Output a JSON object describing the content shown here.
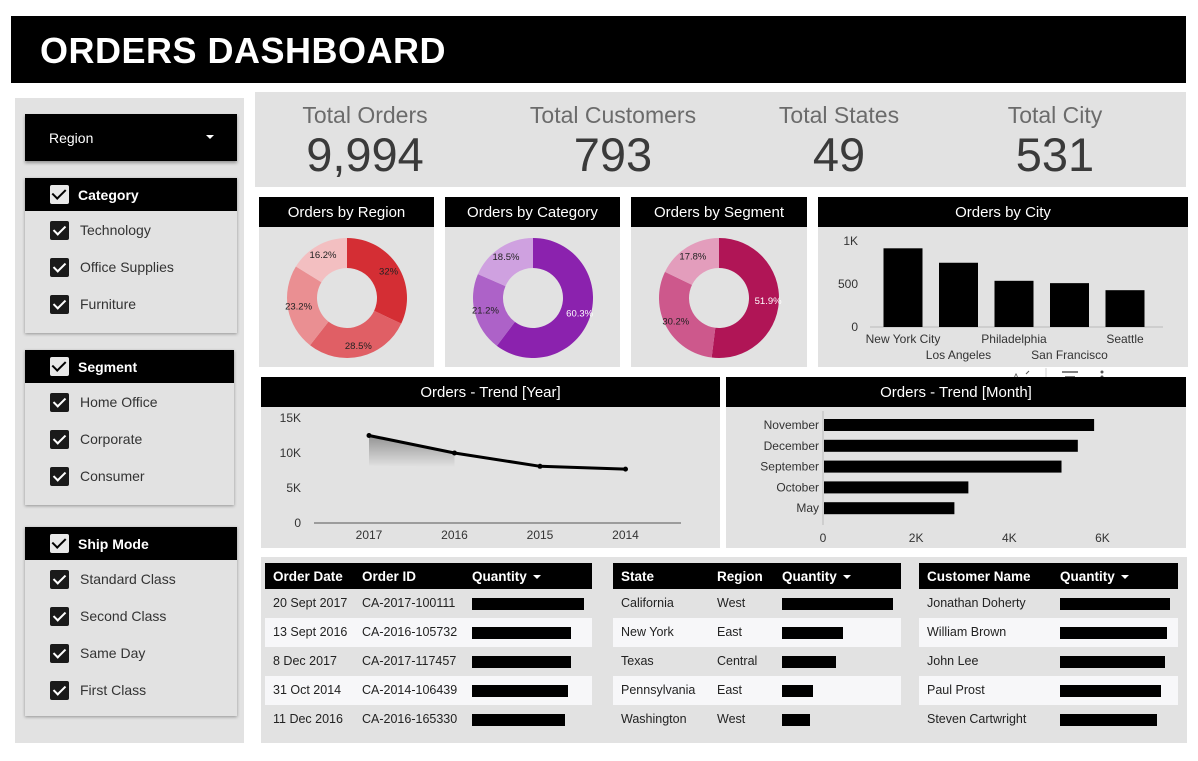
{
  "header": {
    "title": "ORDERS DASHBOARD"
  },
  "region_dropdown": {
    "label": "Region"
  },
  "filters": {
    "category": {
      "title": "Category",
      "items": [
        "Technology",
        "Office Supplies",
        "Furniture"
      ]
    },
    "segment": {
      "title": "Segment",
      "items": [
        "Home Office",
        "Corporate",
        "Consumer"
      ]
    },
    "ship_mode": {
      "title": "Ship Mode",
      "items": [
        "Standard Class",
        "Second Class",
        "Same Day",
        "First Class"
      ]
    }
  },
  "kpis": [
    {
      "label": "Total Orders",
      "value": "9,994"
    },
    {
      "label": "Total Customers",
      "value": "793"
    },
    {
      "label": "Total States",
      "value": "49"
    },
    {
      "label": "Total City",
      "value": "531"
    }
  ],
  "chart_data": [
    {
      "type": "pie",
      "title": "Orders by Region",
      "slices": [
        {
          "label": "32%",
          "value": 32,
          "color": "#d42e34"
        },
        {
          "label": "28.5%",
          "value": 28.5,
          "color": "#e05f65"
        },
        {
          "label": "23.2%",
          "value": 23.2,
          "color": "#ea8f92"
        },
        {
          "label": "16.2%",
          "value": 16.2,
          "color": "#f3bfc1"
        }
      ]
    },
    {
      "type": "pie",
      "title": "Orders by Category",
      "slices": [
        {
          "label": "60.3%",
          "value": 60.3,
          "color": "#8b22ae"
        },
        {
          "label": "21.2%",
          "value": 21.2,
          "color": "#ad62c8"
        },
        {
          "label": "18.5%",
          "value": 18.5,
          "color": "#cfa1e0"
        }
      ]
    },
    {
      "type": "pie",
      "title": "Orders by Segment",
      "slices": [
        {
          "label": "51.9%",
          "value": 51.9,
          "color": "#b01556"
        },
        {
          "label": "30.2%",
          "value": 30.2,
          "color": "#cd588c"
        },
        {
          "label": "17.8%",
          "value": 17.8,
          "color": "#e39dbc"
        }
      ]
    },
    {
      "type": "bar",
      "title": "Orders by City",
      "categories": [
        "New York City",
        "Los Angeles",
        "Philadelphia",
        "San Francisco",
        "Seattle"
      ],
      "values": [
        915,
        747,
        537,
        510,
        428
      ],
      "ylim": [
        0,
        1000
      ],
      "yticks": [
        "1K",
        "500",
        "0"
      ]
    },
    {
      "type": "line",
      "title": "Orders -  Trend [Year]",
      "x": [
        "2017",
        "2016",
        "2015",
        "2014"
      ],
      "values": [
        12500,
        10000,
        8100,
        7700
      ],
      "ylim": [
        0,
        15000
      ],
      "yticks": [
        "15K",
        "10K",
        "5K",
        "0"
      ]
    },
    {
      "type": "bar",
      "orientation": "horizontal",
      "title": "Orders -  Trend [Month]",
      "categories": [
        "November",
        "December",
        "September",
        "October",
        "May"
      ],
      "values": [
        5800,
        5450,
        5100,
        3100,
        2800
      ],
      "xlim": [
        0,
        7000
      ],
      "xticks": [
        "0",
        "2K",
        "4K",
        "6K"
      ]
    }
  ],
  "chart_tools": [
    "az-sort-icon",
    "filter-icon",
    "more-vert-icon"
  ],
  "tables": {
    "orders": {
      "columns": [
        "Order Date",
        "Order ID",
        "Quantity"
      ],
      "rows": [
        {
          "date": "20 Sept 2017",
          "id": "CA-2017-100111",
          "qty": 1.0
        },
        {
          "date": "13 Sept 2016",
          "id": "CA-2016-105732",
          "qty": 0.88
        },
        {
          "date": "8 Dec 2017",
          "id": "CA-2017-117457",
          "qty": 0.88
        },
        {
          "date": "31 Oct 2014",
          "id": "CA-2014-106439",
          "qty": 0.86
        },
        {
          "date": "11 Dec 2016",
          "id": "CA-2016-165330",
          "qty": 0.83
        }
      ]
    },
    "states": {
      "columns": [
        "State",
        "Region",
        "Quantity"
      ],
      "rows": [
        {
          "state": "California",
          "region": "West",
          "qty": 1.0
        },
        {
          "state": "New York",
          "region": "East",
          "qty": 0.55
        },
        {
          "state": "Texas",
          "region": "Central",
          "qty": 0.49
        },
        {
          "state": "Pennsylvania",
          "region": "East",
          "qty": 0.28
        },
        {
          "state": "Washington",
          "region": "West",
          "qty": 0.25
        }
      ]
    },
    "customers": {
      "columns": [
        "Customer Name",
        "Quantity"
      ],
      "rows": [
        {
          "name": "Jonathan Doherty",
          "qty": 1.0
        },
        {
          "name": "William Brown",
          "qty": 0.97
        },
        {
          "name": "John Lee",
          "qty": 0.95
        },
        {
          "name": "Paul Prost",
          "qty": 0.92
        },
        {
          "name": "Steven Cartwright",
          "qty": 0.88
        }
      ]
    }
  }
}
